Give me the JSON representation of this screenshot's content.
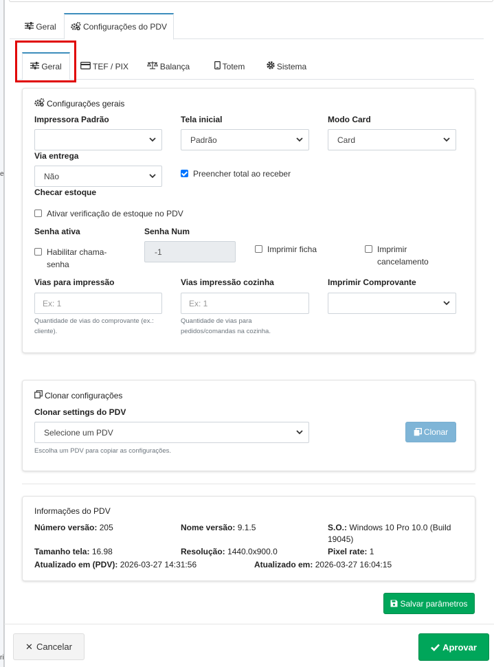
{
  "tabs_main": [
    {
      "label": "Geral",
      "icon": "sliders-icon"
    },
    {
      "label": "Configurações do PDV",
      "icon": "cogs-icon"
    }
  ],
  "tabs_sub": [
    {
      "label": "Geral",
      "icon": "sliders-icon"
    },
    {
      "label": "TEF / PIX",
      "icon": "credit-card-icon"
    },
    {
      "label": "Balança",
      "icon": "balance-scale-icon"
    },
    {
      "label": "Totem",
      "icon": "tablet-icon"
    },
    {
      "label": "Sistema",
      "icon": "gear-icon"
    }
  ],
  "config": {
    "title": "Configurações gerais",
    "impressora_label": "Impressora Padrão",
    "impressora_value": "",
    "tela_label": "Tela inicial",
    "tela_value": "Padrão",
    "modo_label": "Modo Card",
    "modo_value": "Card",
    "via_label": "Via entrega",
    "via_value": "Não",
    "preencher_label": "Preencher total ao receber",
    "preencher_checked": true,
    "checar_label": "Checar estoque",
    "ativar_label": "Ativar verificação de estoque no PDV",
    "senha_ativa_label": "Senha ativa",
    "habilitar_line1": "Habilitar chama-",
    "habilitar_line2": "senha",
    "senha_num_label": "Senha Num",
    "senha_num_value": "-1",
    "imprimir_ficha_label": "Imprimir ficha",
    "imprimir_canc_line1": "Imprimir",
    "imprimir_canc_line2": "cancelamento",
    "vias_label": "Vias para impressão",
    "vias_placeholder": "Ex: 1",
    "vias_help_line1": "Quantidade de vias do comprovante (ex.:",
    "vias_help_line2": "cliente).",
    "vias_coz_label": "Vias impressão cozinha",
    "vias_coz_placeholder": "Ex: 1",
    "vias_coz_help_line1": "Quantidade de vias para",
    "vias_coz_help_line2": "pedidos/comandas na cozinha.",
    "imprimir_comp_label": "Imprimir Comprovante",
    "imprimir_comp_value": ""
  },
  "clone": {
    "title": "Clonar configurações",
    "label": "Clonar settings do PDV",
    "select_value": "Selecione um PDV",
    "help": "Escolha um PDV para copiar as configurações.",
    "button": "Clonar"
  },
  "info": {
    "title": "Informações do PDV",
    "numero_label": "Número versão:",
    "numero_value": "205",
    "nome_label": "Nome versão:",
    "nome_value": "9.1.5",
    "so_label": "S.O.:",
    "so_value_line1": "Windows 10 Pro 10.0 (Build",
    "so_value_line2": "19045)",
    "tamanho_label": "Tamanho tela:",
    "tamanho_value": "16.98",
    "resolucao_label": "Resolução:",
    "resolucao_value": "1440.0x900.0",
    "pixel_label": "Pixel rate:",
    "pixel_value": "1",
    "atual_pdv_label": "Atualizado em (PDV):",
    "atual_pdv_value": "2026-03-27 14:31:56",
    "atual_label": "Atualizado em:",
    "atual_value": "2026-03-27 16:04:15"
  },
  "buttons": {
    "save": "Salvar parâmetros",
    "cancel": "Cancelar",
    "approve": "Aprovar"
  },
  "background_fragments": [
    "e",
    "ri"
  ],
  "colors": {
    "accent": "#3c8dbc",
    "success": "#00a65a",
    "highlight": "#e00000",
    "clone_button": "#7fb5d7"
  }
}
